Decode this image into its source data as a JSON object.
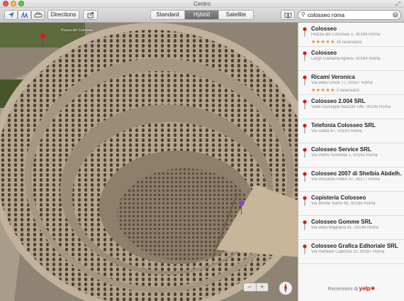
{
  "window": {
    "title": "Centro",
    "traffic_light_colors": [
      "#ee5b54",
      "#f5be4f",
      "#63c556"
    ]
  },
  "toolbar": {
    "location_icon": "location-arrow-icon",
    "threed_icon": "3d-icon",
    "traffic_icon": "car-icon",
    "directions_label": "Directions",
    "share_icon": "share-icon",
    "map_modes": [
      "Standard",
      "Hybrid",
      "Satellite"
    ],
    "active_mode": "Hybrid",
    "bookmarks_icon": "book-icon",
    "search_value": "colosseo roma",
    "search_icon": "search-icon",
    "clear_icon": "clear-icon"
  },
  "map": {
    "street_label": "Piazza del Colosseo",
    "zoom_out": "−",
    "zoom_in": "+",
    "pin_color": "#d0211c",
    "selected_pin_color": "#8a3fc7"
  },
  "results": [
    {
      "name": "Colosseo",
      "address": "Piazza del Colosseo 1, 00184 Roma",
      "stars": "★★★★★",
      "reviews": "42 recensioni"
    },
    {
      "name": "Colosseo",
      "address": "Largo Gaetana Agnesi, 00184 Roma"
    },
    {
      "name": "Ricami Veronica",
      "address": "Via della Croce 77, 00187 Roma",
      "stars": "★★★★★",
      "reviews": "2 recensioni"
    },
    {
      "name": "Colosseo 2.004 SRL",
      "address": "Viale Giuseppe Mazzini 146, 00195 Roma"
    },
    {
      "name": "Telefonia Colosseo SRL",
      "address": "Via Gallia 67, 00183 Roma"
    },
    {
      "name": "Colosseo Service SRL",
      "address": "Via Pietro l'Eremita 1, 00162 Roma"
    },
    {
      "name": "Colosseo 2007 di Shelbia Abdelh...",
      "address": "Via Riccardo Pitteri 37, 00177 Roma"
    },
    {
      "name": "Copisteria Colosseo",
      "address": "Via Monte Santo 68, 00195 Roma"
    },
    {
      "name": "Colosseo Gomme SRL",
      "address": "Via della Magliana 61, 00146 Roma"
    },
    {
      "name": "Colosseo Grafica Editoriale SRL",
      "address": "Via Raffaele Cadorna 22, 00187 Roma"
    }
  ],
  "footer": {
    "reviews_label": "Recensioni di",
    "yelp_logo": "yelp"
  }
}
